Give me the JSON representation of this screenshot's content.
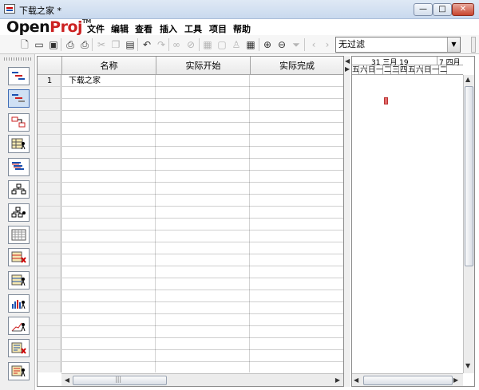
{
  "window": {
    "title": "下载之家 *",
    "controls": {
      "minimize": "—",
      "maximize": "□",
      "close": "✕"
    }
  },
  "logo": {
    "part1": "Open",
    "part2": "Proj",
    "tm": "TM"
  },
  "menu": [
    "文件",
    "编辑",
    "查看",
    "插入",
    "工具",
    "项目",
    "帮助"
  ],
  "toolbar": {
    "icons": [
      "new-task-icon",
      "open-icon",
      "save-icon",
      "print-icon",
      "print-preview-icon",
      "cut-icon",
      "copy-icon",
      "paste-icon",
      "undo-icon",
      "redo-icon",
      "link-icon",
      "unlink-icon",
      "task-info-icon",
      "notes-icon",
      "assign-resources-icon",
      "calendar-icon",
      "zoom-in-icon",
      "zoom-out-icon",
      "filter-icon",
      "scroll-left-icon",
      "scroll-right-icon"
    ],
    "filter_value": "无过滤"
  },
  "sidebar": {
    "views": [
      "gantt-view",
      "tracking-gantt-view",
      "network-view",
      "resource-sheet-view",
      "wbs-view",
      "task-tree-view",
      "resource-tree-view",
      "project-view",
      "task-usage-view",
      "resource-usage-view",
      "histogram-view",
      "chart-view",
      "report-view",
      "task-report-view"
    ],
    "active_index": 1
  },
  "grid": {
    "columns": [
      "名称",
      "实际开始",
      "实际完成"
    ],
    "rows": [
      {
        "id": "1",
        "name": "下载之家",
        "actual_start": "",
        "actual_finish": ""
      }
    ]
  },
  "gantt": {
    "header_top": [
      "31 三月 19",
      "7 四月"
    ],
    "days": [
      "五",
      "六",
      "日",
      "一",
      "二",
      "三",
      "四",
      "五",
      "六",
      "日",
      "一",
      "二"
    ],
    "milestone_color": "#e06b6b"
  },
  "colors": {
    "accent": "#3d6bb5",
    "close_button": "#c8452e"
  }
}
